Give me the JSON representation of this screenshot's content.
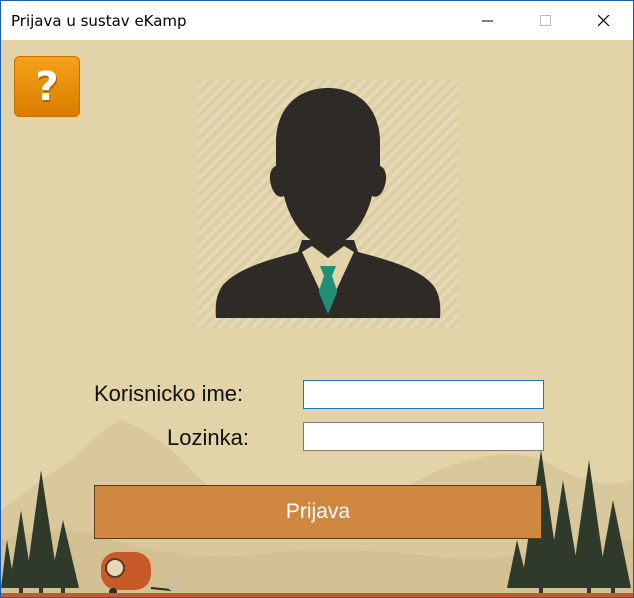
{
  "window": {
    "title": "Prijava u sustav eKamp",
    "controls": {
      "minimize_icon": "minimize-icon",
      "maximize_icon": "maximize-icon",
      "close_icon": "close-icon"
    }
  },
  "help": {
    "label": "?"
  },
  "form": {
    "username_label": "Korisnicko ime:",
    "username_value": "",
    "password_label": "Lozinka:",
    "password_value": ""
  },
  "login_button": {
    "label": "Prijava"
  },
  "colors": {
    "background": "#e2d3a8",
    "help_button": "#f39c12",
    "login_button": "#d08740",
    "silhouette": "#2e2b26",
    "tie": "#1f8f78",
    "trees": "#2f3a2a",
    "ground": "#c85a2a"
  }
}
